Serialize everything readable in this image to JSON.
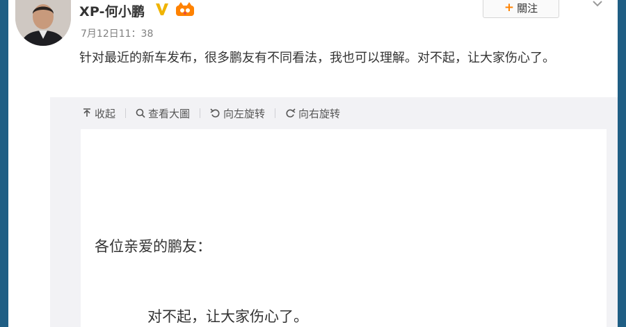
{
  "post": {
    "username": "XP-何小鹏",
    "timestamp": "7月12日11：38",
    "text": "针对最近的新车发布，很多鹏友有不同看法，我也可以理解。对不起，让大家伤心了。",
    "follow_plus": "+",
    "follow_label": "關注",
    "icons": [
      "avatar",
      "verified-v-icon",
      "vip-icon",
      "chevron-down-icon"
    ]
  },
  "media": {
    "tools": [
      {
        "icon": "collapse-arrow-icon",
        "label": "收起"
      },
      {
        "icon": "search-icon",
        "label": "查看大圖"
      },
      {
        "icon": "rotate-left-icon",
        "label": "向左旋转"
      },
      {
        "icon": "rotate-right-icon",
        "label": "向右旋转"
      }
    ],
    "letter": {
      "greeting": "各位亲爱的鹏友：",
      "line1": "对不起，让大家伤心了。"
    }
  },
  "colors": {
    "frame": "#1f5e84",
    "accent_orange": "#ff8200",
    "verified_gold": "#f0b400",
    "panel_bg": "#f2f2f5"
  }
}
